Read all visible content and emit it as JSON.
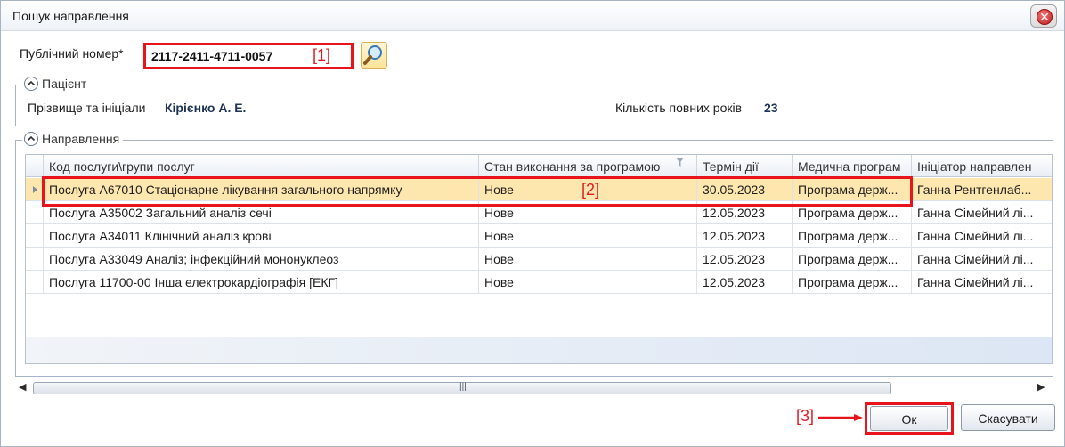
{
  "window": {
    "title": "Пошук направлення",
    "close_icon": "close-icon"
  },
  "search": {
    "label": "Публічний номер*",
    "value": "2117-2411-4711-0057",
    "marker": "[1]",
    "search_icon": "magnifier-icon"
  },
  "patient": {
    "caption": "Пацієнт",
    "name_label": "Прізвище та ініціали",
    "name_value": "Кірієнко А. Е.",
    "age_label": "Кількість повних років",
    "age_value": "23"
  },
  "referrals": {
    "caption": "Направлення",
    "columns": [
      "Код послуги\\групи послуг",
      "Стан виконання за програмою",
      "Термін дії",
      "Медична програм",
      "Ініціатор направлен"
    ],
    "rows": [
      {
        "code": "Послуга A67010 Стаціонарне лікування загального напрямку",
        "status": "Нове",
        "valid": "30.05.2023",
        "program": "Програма держ...",
        "initiator": "Ганна Рентгенлаб..."
      },
      {
        "code": "Послуга A35002 Загальний аналіз сечі",
        "status": "Нове",
        "valid": "12.05.2023",
        "program": "Програма держ...",
        "initiator": "Ганна Сімейний лі..."
      },
      {
        "code": "Послуга A34011 Клінічний аналіз крові",
        "status": "Нове",
        "valid": "12.05.2023",
        "program": "Програма держ...",
        "initiator": "Ганна Сімейний лі..."
      },
      {
        "code": "Послуга A33049 Аналіз; інфекційний мононуклеоз",
        "status": "Нове",
        "valid": "12.05.2023",
        "program": "Програма держ...",
        "initiator": "Ганна Сімейний лі..."
      },
      {
        "code": "Послуга 11700-00 Інша електрокардіографія [ЕКГ]",
        "status": "Нове",
        "valid": "12.05.2023",
        "program": "Програма держ...",
        "initiator": "Ганна Сімейний лі..."
      }
    ],
    "selected_index": 0,
    "marker": "[2]"
  },
  "buttons": {
    "ok": "Ок",
    "cancel": "Скасувати",
    "marker": "[3]"
  },
  "colors": {
    "highlight": "#e8141b",
    "selected_row": "#fde7ae",
    "accent_text": "#1d3355"
  }
}
